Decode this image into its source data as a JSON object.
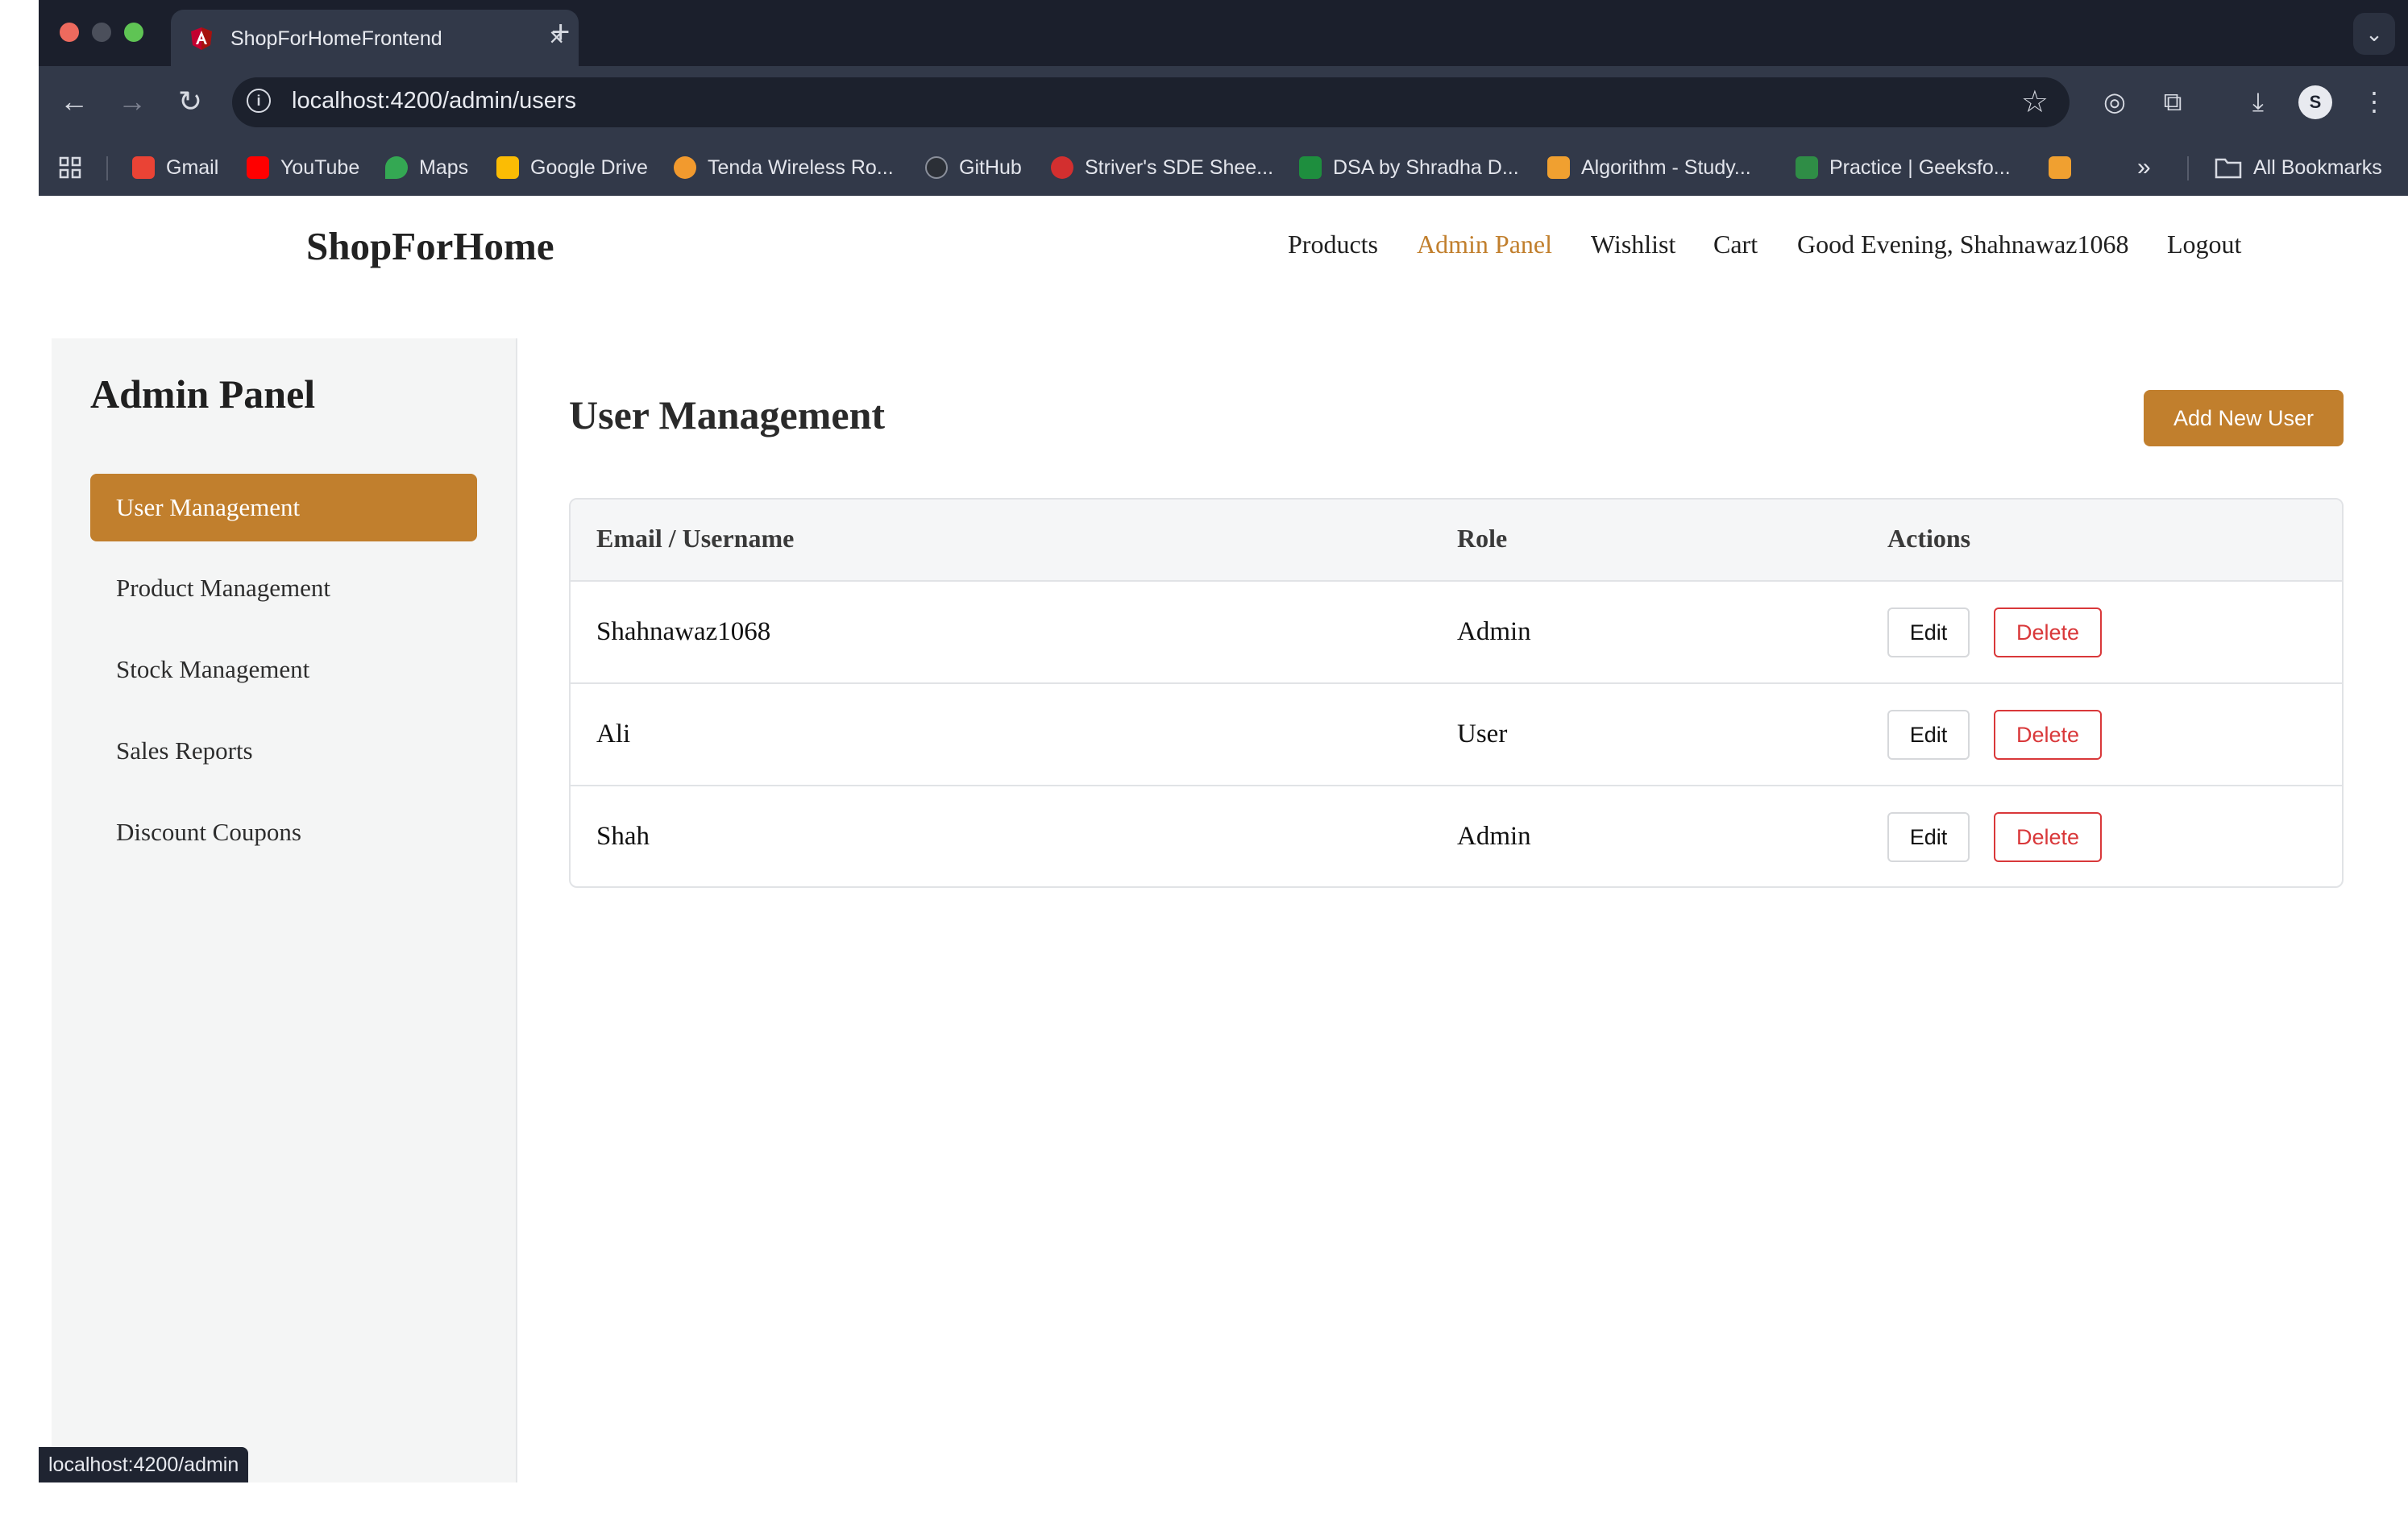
{
  "browser": {
    "tab_title": "ShopForHomeFrontend",
    "url": "localhost:4200/admin/users",
    "bookmarks": [
      {
        "label": "Gmail",
        "color": "#ea4335"
      },
      {
        "label": "YouTube",
        "color": "#ff0000"
      },
      {
        "label": "Maps",
        "color": "#34a853"
      },
      {
        "label": "Google Drive",
        "color": "#fbbc04"
      },
      {
        "label": "Tenda Wireless Ro...",
        "color": "#f29a2e"
      },
      {
        "label": "GitHub",
        "color": "#2b2f36"
      },
      {
        "label": "Striver's SDE Shee...",
        "color": "#d32f2f"
      },
      {
        "label": "DSA by Shradha D...",
        "color": "#1e8e3e"
      },
      {
        "label": "Algorithm - Study...",
        "color": "#f0a030"
      },
      {
        "label": "Practice | Geeksfo...",
        "color": "#2f8d46"
      }
    ],
    "all_bookmarks_label": "All Bookmarks",
    "status_url": "localhost:4200/admin"
  },
  "header": {
    "brand": "ShopForHome",
    "nav": {
      "products": "Products",
      "admin_panel": "Admin Panel",
      "wishlist": "Wishlist",
      "cart": "Cart",
      "greeting": "Good Evening, Shahnawaz1068",
      "logout": "Logout"
    },
    "accent_color": "#c17f2d"
  },
  "sidebar": {
    "title": "Admin Panel",
    "items": [
      {
        "label": "User Management",
        "active": true
      },
      {
        "label": "Product Management",
        "active": false
      },
      {
        "label": "Stock Management",
        "active": false
      },
      {
        "label": "Sales Reports",
        "active": false
      },
      {
        "label": "Discount Coupons",
        "active": false
      }
    ]
  },
  "main": {
    "title": "User Management",
    "add_button": "Add New User",
    "table": {
      "headers": [
        "Email / Username",
        "Role",
        "Actions"
      ],
      "edit_label": "Edit",
      "delete_label": "Delete",
      "rows": [
        {
          "username": "Shahnawaz1068",
          "role": "Admin"
        },
        {
          "username": "Ali",
          "role": "User"
        },
        {
          "username": "Shah",
          "role": "Admin"
        }
      ]
    }
  }
}
